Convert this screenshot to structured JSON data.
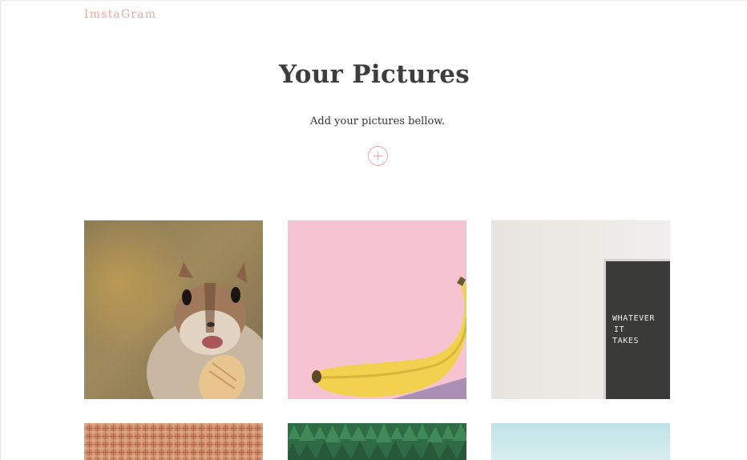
{
  "header": {
    "logo_text": "ImstaGram"
  },
  "main": {
    "title": "Your Pictures",
    "subtitle": "Add your pictures bellow.",
    "add_button_icon": "plus-circle-icon"
  },
  "gallery": {
    "photos": [
      {
        "subject": "chipmunk-photo"
      },
      {
        "subject": "banana-photo"
      },
      {
        "subject": "letter-board-photo",
        "board_lines": [
          "WHATEVER",
          "IT",
          "TAKES"
        ]
      },
      {
        "subject": "plaid-fabric-photo"
      },
      {
        "subject": "pine-forest-photo"
      },
      {
        "subject": "sky-photo"
      }
    ]
  },
  "colors": {
    "accent": "#f0a89d",
    "title": "#3d3d3d",
    "add_button": "#f2a5ad"
  }
}
